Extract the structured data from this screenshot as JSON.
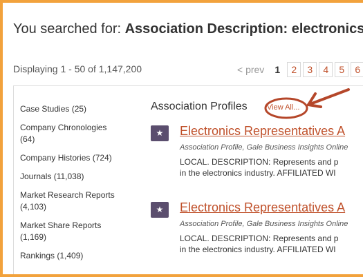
{
  "search": {
    "prefix": "You searched for: ",
    "query": "Association Description: electronics"
  },
  "results": {
    "count_text": "Displaying 1 - 50 of 1,147,200"
  },
  "pager": {
    "prev_label": "< prev",
    "current": "1",
    "pages": [
      "2",
      "3",
      "4",
      "5",
      "6"
    ]
  },
  "facets": [
    "Case Studies (25)",
    "Company Chronologies (64)",
    "Company Histories (724)",
    "Journals (11,038)",
    "Market Research Reports (4,103)",
    "Market Share Reports (1,169)",
    "Rankings (1,409)"
  ],
  "section": {
    "title": "Association Profiles",
    "view_all": "View All..."
  },
  "result_items": [
    {
      "title": "Electronics Representatives A",
      "source": "Association Profile, Gale Business Insights Online",
      "desc_line1": "LOCAL. DESCRIPTION: Represents and p",
      "desc_line2": "in the electronics industry. AFFILIATED WI"
    },
    {
      "title": "Electronics Representatives A",
      "source": "Association Profile, Gale Business Insights Online",
      "desc_line1": "LOCAL. DESCRIPTION: Represents and p",
      "desc_line2": "in the electronics industry. AFFILIATED WI"
    }
  ],
  "colors": {
    "frame_border": "#f2a23c",
    "link": "#c0512b",
    "annotation": "#b5472a",
    "icon_bg": "#5b4e6e"
  },
  "icons": {
    "result_icon": "star-icon",
    "annotation": "arrow-icon"
  }
}
